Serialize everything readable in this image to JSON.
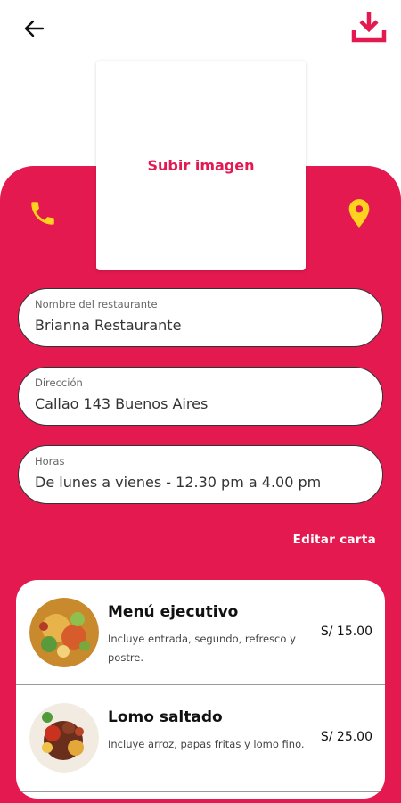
{
  "header": {
    "back_icon": "arrow-left-icon",
    "download_icon": "download-icon"
  },
  "upload": {
    "label": "Subir imagen"
  },
  "actions": {
    "phone_icon": "phone-icon",
    "location_icon": "map-pin-icon"
  },
  "fields": [
    {
      "label": "Nombre del restaurante",
      "value": "Brianna Restaurante"
    },
    {
      "label": "Dirección",
      "value": "Callao 143 Buenos Aires"
    },
    {
      "label": "Horas",
      "value": "De lunes a vienes - 12.30 pm a 4.00 pm"
    }
  ],
  "edit_menu_label": "Editar carta",
  "menu": [
    {
      "name": "Menú ejecutivo",
      "description": "Incluye entrada, segundo, refresco y postre.",
      "price": "S/ 15.00"
    },
    {
      "name": "Lomo saltado",
      "description": "Incluye arroz, papas fritas y lomo fino.",
      "price": "S/ 25.00"
    }
  ],
  "colors": {
    "accent": "#e3194f",
    "icon_yellow": "#ffd21f"
  }
}
